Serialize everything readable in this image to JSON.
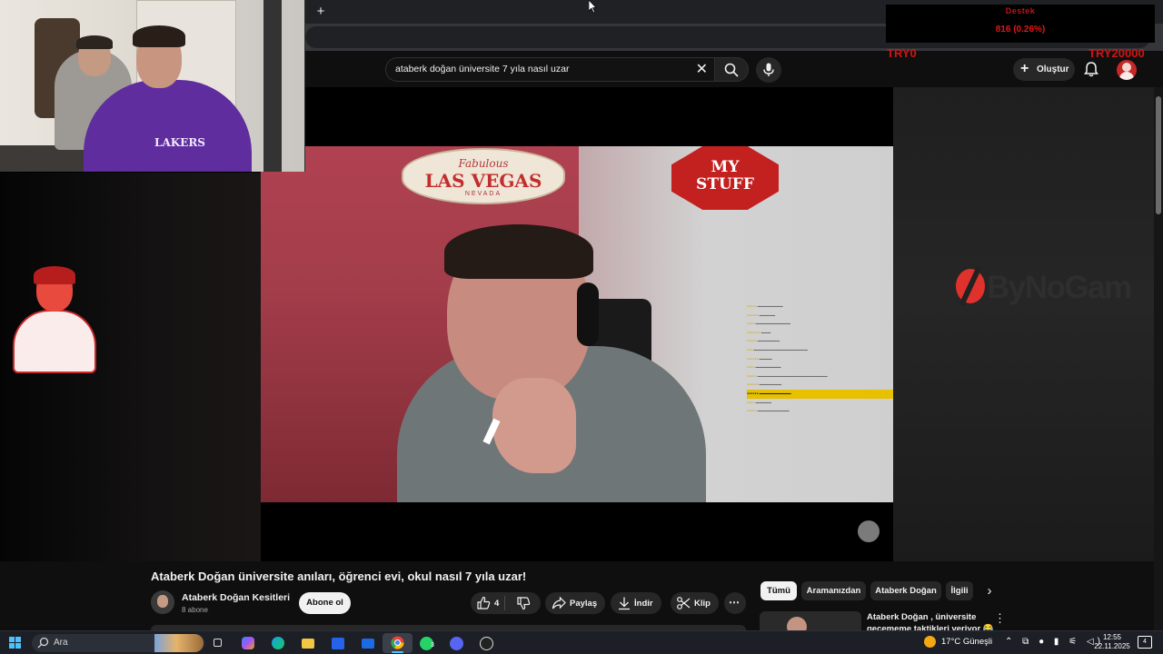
{
  "browser": {
    "new_tab_label": "+",
    "window_controls": [
      "—",
      "❐",
      "✕"
    ]
  },
  "donation_overlay": {
    "label": "Destek",
    "amount": "816 (0.26%)",
    "left_tag": "TRY0",
    "right_tag": "TRY20000"
  },
  "youtube": {
    "search": {
      "query": "ataberk doğan üniversite 7 yıla nasıl uzar",
      "clear_icon": "close-icon",
      "search_icon": "search-icon",
      "mic_icon": "mic-icon"
    },
    "header": {
      "create_label": "Oluştur",
      "bell_icon": "bell-icon"
    },
    "video": {
      "title": "Ataberk Doğan üniversite anıları, öğrenci evi, okul nasıl 7 yıla uzar!",
      "sign_left": {
        "line1": "Fabulous",
        "line2": "LAS VEGAS",
        "line3": "NEVADA"
      },
      "sign_right": {
        "line1": "MY",
        "line2": "STUFF"
      },
      "sponsor_logo": "ByNoGam",
      "webcam_shirt_text": "LAKERS"
    },
    "channel": {
      "name": "Ataberk Doğan Kesitleri",
      "subscribers": "8 abone",
      "subscribe_label": "Abone ol"
    },
    "actions": {
      "like_count": "4",
      "share_label": "Paylaş",
      "download_label": "İndir",
      "clip_label": "Klip",
      "more_label": "⋯"
    },
    "chips": [
      "Tümü",
      "Aramanızdan",
      "Ataberk Doğan",
      "İlgili"
    ],
    "chip_next": "›",
    "recommendation": {
      "title": "Ataberk Doğan , üniversite geçememe taktikleri veriyor 😂"
    }
  },
  "taskbar": {
    "search_placeholder": "Ara",
    "weather": "17°C  Güneşli",
    "tray_icons": "⌃ ⧉ ● ▮ ⚟ ◁)",
    "time": "12:55",
    "date": "22.11.2025",
    "notifications": "4",
    "whatsapp_badge": "3"
  },
  "colors": {
    "accent_red": "#e01818",
    "yt_bg": "#0f0f0f",
    "chip_active": "#f1f1f1",
    "taskbar_bg": "#1c1f26",
    "highlight_yellow": "#e7c000"
  }
}
